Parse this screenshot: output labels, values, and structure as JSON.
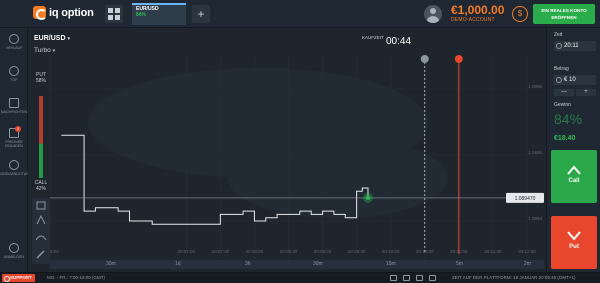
{
  "header": {
    "logo_text": "iq option",
    "active_tab": {
      "name": "EUR/USD",
      "payout": "84%"
    },
    "add_tab_label": "+",
    "balance": "€1,000.00",
    "account_type": "DEMO-ACCOUNT",
    "real_account_button": "EIN REALES KONTO ERÖFFNEN"
  },
  "sidebar": {
    "items": [
      {
        "label": "VERLAUF",
        "icon": "history-icon"
      },
      {
        "label": "TOP",
        "icon": "top-icon"
      },
      {
        "label": "NACHRICHTEN",
        "icon": "news-icon"
      },
      {
        "label": "FREUNDE EINLADEN",
        "icon": "gift-icon",
        "badge": "1"
      },
      {
        "label": "VIDEOANLEITUNG",
        "icon": "video-icon"
      },
      {
        "label": "ANMELDEN",
        "icon": "login-icon"
      }
    ]
  },
  "chart": {
    "pair": "EUR/USD",
    "mode": "Turbo",
    "purchase_label": "KAUFZEIT",
    "countdown": "00:44",
    "put_label": "PUT",
    "put_pct": "58%",
    "call_label": "CALL",
    "call_pct": "42%",
    "current_price": "1.089470",
    "price_ticks": [
      "1.0898",
      "1.0896",
      "1.0894"
    ],
    "time_ticks": [
      "20:05:00",
      "20:07:00",
      "20:07:30",
      "20:08:00",
      "20:08:30",
      "20:09:00",
      "20:09:30",
      "20:10:00",
      "20:10:30",
      "20:11:00",
      "20:11:30",
      "20:12:00"
    ],
    "periods": [
      "30m",
      "1d",
      "3h",
      "30m",
      "15m",
      "5m",
      "2m"
    ],
    "colors": {
      "line": "#e6e9ec",
      "expiry": "#e8462d",
      "purchase": "#c9cfd6",
      "accent": "#2bbd52"
    }
  },
  "chart_data": {
    "type": "line",
    "title": "",
    "xlabel": "",
    "ylabel": "",
    "ylim": [
      1.0893,
      1.0899
    ],
    "series": [
      {
        "x": [
          "20:05:10",
          "20:05:30",
          "20:05:40",
          "20:05:50",
          "20:06:00",
          "20:06:10",
          "20:06:30",
          "20:06:50",
          "20:07:10",
          "20:07:30",
          "20:07:40",
          "20:07:50",
          "20:08:00",
          "20:08:10",
          "20:08:20",
          "20:08:30",
          "20:08:40",
          "20:08:50",
          "20:09:00",
          "20:09:10",
          "20:09:20",
          "20:09:25",
          "20:09:30",
          "20:09:35",
          "20:09:40"
        ],
        "values": [
          1.08966,
          1.08943,
          1.08944,
          1.08944,
          1.08943,
          1.0894,
          1.08939,
          1.08939,
          1.08939,
          1.08942,
          1.08942,
          1.08943,
          1.0894,
          1.08941,
          1.08942,
          1.08942,
          1.08943,
          1.08942,
          1.08943,
          1.08942,
          1.08941,
          1.08941,
          1.08949,
          1.0895,
          1.08947
        ]
      }
    ],
    "grid": true
  },
  "trade_panel": {
    "time_label": "Zeit",
    "time_value": "20:11",
    "amount_label": "Betrag",
    "amount_value": "€ 10",
    "minus": "—",
    "plus": "+",
    "profit_label": "Gewinn",
    "profit_pct": "84%",
    "profit_amount": "€18.40",
    "call_button": "Call",
    "put_button": "Put"
  },
  "footer": {
    "support": "SUPPORT",
    "hours": "MO. - FR.: 7:00-18:00 (GMT)",
    "platform_time": "ZEIT AUF DER PLATTFORM: 18 JANUAR 20:09:46 (GMT+1)"
  }
}
